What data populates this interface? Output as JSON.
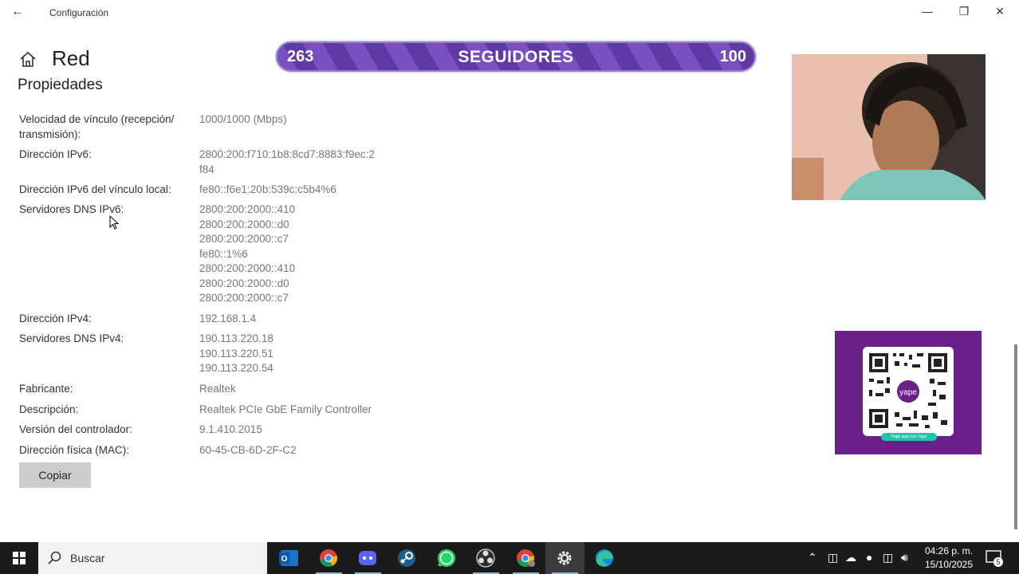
{
  "window": {
    "title": "Configuración"
  },
  "header": {
    "title": "Red",
    "section": "Propiedades"
  },
  "properties": [
    {
      "label": "Velocidad de vínculo (recepción/ transmisión):",
      "value": "1000/1000 (Mbps)"
    },
    {
      "label": "Dirección IPv6:",
      "value": "2800:200:f710:1b8:8cd7:8883:f9ec:2f84"
    },
    {
      "label": "Dirección IPv6 del vínculo local:",
      "value": "fe80::f6e1:20b:539c:c5b4%6"
    },
    {
      "label": "Servidores DNS IPv6:",
      "value": "2800:200:2000::410\n2800:200:2000::d0\n2800:200:2000::c7\nfe80::1%6\n2800:200:2000::410\n2800:200:2000::d0\n2800:200:2000::c7"
    },
    {
      "label": "Dirección IPv4:",
      "value": "192.168.1.4"
    },
    {
      "label": "Servidores DNS IPv4:",
      "value": "190.113.220.18\n190.113.220.51\n190.113.220.54"
    },
    {
      "label": "Fabricante:",
      "value": "Realtek"
    },
    {
      "label": "Descripción:",
      "value": "Realtek PCIe GbE Family Controller"
    },
    {
      "label": "Versión del controlador:",
      "value": "9.1.410.2015"
    },
    {
      "label": "Dirección física (MAC):",
      "value": "60-45-CB-6D-2F-C2"
    }
  ],
  "copy_button": "Copiar",
  "overlay": {
    "left": "263",
    "center": "SEGUIDORES",
    "right": "100"
  },
  "qr": {
    "caption": "Paga aquí con Yape"
  },
  "taskbar": {
    "search_placeholder": "Buscar",
    "apps": [
      "outlook-icon",
      "chrome-icon",
      "discord-icon",
      "steam-icon",
      "whatsapp-icon",
      "obs-icon",
      "chrome-profile-icon",
      "settings-icon",
      "edge-icon"
    ],
    "time": "04:26 p. m.",
    "date": "15/10/2025",
    "notifications": "5"
  },
  "colors": {
    "banner": "#6a42b5",
    "qr_bg": "#6b1f8a",
    "taskbar": "#1b1b1b",
    "button": "#cccccc"
  }
}
